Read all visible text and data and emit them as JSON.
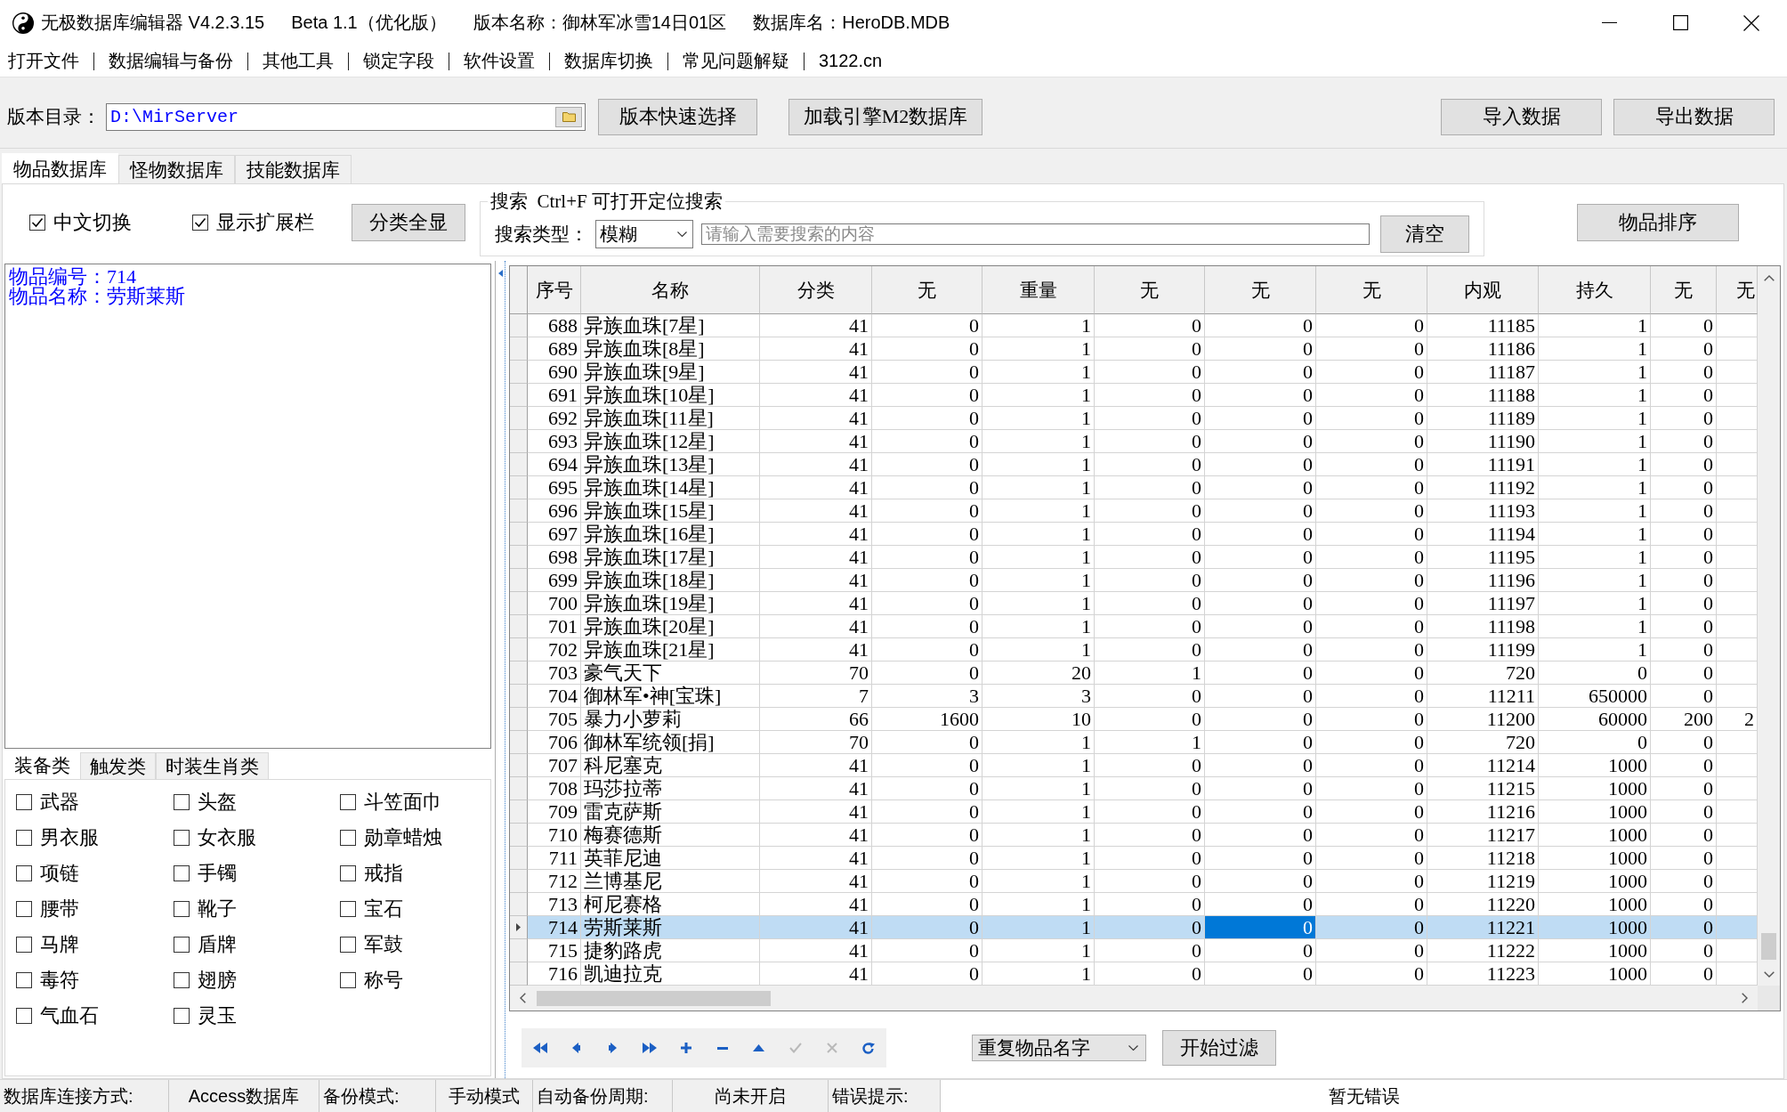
{
  "window": {
    "title_parts": [
      "无极数据库编辑器 V4.2.3.15",
      "Beta 1.1（优化版）",
      "版本名称：御林军冰雪14日01区",
      "数据库名：HeroDB.MDB"
    ]
  },
  "menu": [
    "打开文件",
    "数据编辑与备份",
    "其他工具",
    "锁定字段",
    "软件设置",
    "数据库切换",
    "常见问题解疑",
    "3122.cn"
  ],
  "toolbar": {
    "path_label": "版本目录：",
    "path_value": "D:\\MirServer",
    "left_buttons": [
      "版本快速选择",
      "加载引擎M2数据库"
    ],
    "right_buttons": [
      "导入数据",
      "导出数据"
    ]
  },
  "main_tabs": [
    {
      "label": "物品数据库",
      "selected": true
    },
    {
      "label": "怪物数据库",
      "selected": false
    },
    {
      "label": "技能数据库",
      "selected": false
    }
  ],
  "options": [
    {
      "label": "中文切换",
      "checked": true
    },
    {
      "label": "显示扩展栏",
      "checked": true
    }
  ],
  "show_all_button": "分类全显",
  "search": {
    "caption": "搜索  Ctrl+F 可打开定位搜索",
    "type_label": "搜索类型：",
    "type_value": "模糊",
    "placeholder": "请输入需要搜索的内容",
    "clear_button": "清空"
  },
  "sort_button": "物品排序",
  "item_info": [
    "物品编号：714",
    "物品名称：劳斯莱斯"
  ],
  "category_tabs": [
    {
      "label": "装备类",
      "selected": true
    },
    {
      "label": "触发类",
      "selected": false
    },
    {
      "label": "时装生肖类",
      "selected": false
    }
  ],
  "categories": [
    {
      "label": "武器",
      "checked": false
    },
    {
      "label": "头盔",
      "checked": false
    },
    {
      "label": "斗笠面巾",
      "checked": false
    },
    {
      "label": "男衣服",
      "checked": false
    },
    {
      "label": "女衣服",
      "checked": false
    },
    {
      "label": "勋章蜡烛",
      "checked": false
    },
    {
      "label": "项链",
      "checked": false
    },
    {
      "label": "手镯",
      "checked": false
    },
    {
      "label": "戒指",
      "checked": false
    },
    {
      "label": "腰带",
      "checked": false
    },
    {
      "label": "靴子",
      "checked": false
    },
    {
      "label": "宝石",
      "checked": false
    },
    {
      "label": "马牌",
      "checked": false
    },
    {
      "label": "盾牌",
      "checked": false
    },
    {
      "label": "军鼓",
      "checked": false
    },
    {
      "label": "毒符",
      "checked": false
    },
    {
      "label": "翅膀",
      "checked": false
    },
    {
      "label": "称号",
      "checked": false
    },
    {
      "label": "气血石",
      "checked": false
    },
    {
      "label": "灵玉",
      "checked": false
    }
  ],
  "table": {
    "columns": [
      {
        "label": "序号",
        "focused": false
      },
      {
        "label": "名称",
        "focused": false
      },
      {
        "label": "分类",
        "focused": false
      },
      {
        "label": "无",
        "focused": false
      },
      {
        "label": "重量",
        "focused": false
      },
      {
        "label": "无",
        "focused": false
      },
      {
        "label": "无",
        "focused": true
      },
      {
        "label": "无",
        "focused": false
      },
      {
        "label": "内观",
        "focused": false
      },
      {
        "label": "持久",
        "focused": false
      },
      {
        "label": "无",
        "focused": false
      },
      {
        "label": "无",
        "focused": false
      }
    ],
    "rows": [
      {
        "cells": [
          "688",
          "异族血珠[7星]",
          "41",
          "0",
          "1",
          "0",
          "0",
          "0",
          "11185",
          "1",
          "0"
        ],
        "selected": false
      },
      {
        "cells": [
          "689",
          "异族血珠[8星]",
          "41",
          "0",
          "1",
          "0",
          "0",
          "0",
          "11186",
          "1",
          "0"
        ],
        "selected": false
      },
      {
        "cells": [
          "690",
          "异族血珠[9星]",
          "41",
          "0",
          "1",
          "0",
          "0",
          "0",
          "11187",
          "1",
          "0"
        ],
        "selected": false
      },
      {
        "cells": [
          "691",
          "异族血珠[10星]",
          "41",
          "0",
          "1",
          "0",
          "0",
          "0",
          "11188",
          "1",
          "0"
        ],
        "selected": false
      },
      {
        "cells": [
          "692",
          "异族血珠[11星]",
          "41",
          "0",
          "1",
          "0",
          "0",
          "0",
          "11189",
          "1",
          "0"
        ],
        "selected": false
      },
      {
        "cells": [
          "693",
          "异族血珠[12星]",
          "41",
          "0",
          "1",
          "0",
          "0",
          "0",
          "11190",
          "1",
          "0"
        ],
        "selected": false
      },
      {
        "cells": [
          "694",
          "异族血珠[13星]",
          "41",
          "0",
          "1",
          "0",
          "0",
          "0",
          "11191",
          "1",
          "0"
        ],
        "selected": false
      },
      {
        "cells": [
          "695",
          "异族血珠[14星]",
          "41",
          "0",
          "1",
          "0",
          "0",
          "0",
          "11192",
          "1",
          "0"
        ],
        "selected": false
      },
      {
        "cells": [
          "696",
          "异族血珠[15星]",
          "41",
          "0",
          "1",
          "0",
          "0",
          "0",
          "11193",
          "1",
          "0"
        ],
        "selected": false
      },
      {
        "cells": [
          "697",
          "异族血珠[16星]",
          "41",
          "0",
          "1",
          "0",
          "0",
          "0",
          "11194",
          "1",
          "0"
        ],
        "selected": false
      },
      {
        "cells": [
          "698",
          "异族血珠[17星]",
          "41",
          "0",
          "1",
          "0",
          "0",
          "0",
          "11195",
          "1",
          "0"
        ],
        "selected": false
      },
      {
        "cells": [
          "699",
          "异族血珠[18星]",
          "41",
          "0",
          "1",
          "0",
          "0",
          "0",
          "11196",
          "1",
          "0"
        ],
        "selected": false
      },
      {
        "cells": [
          "700",
          "异族血珠[19星]",
          "41",
          "0",
          "1",
          "0",
          "0",
          "0",
          "11197",
          "1",
          "0"
        ],
        "selected": false
      },
      {
        "cells": [
          "701",
          "异族血珠[20星]",
          "41",
          "0",
          "1",
          "0",
          "0",
          "0",
          "11198",
          "1",
          "0"
        ],
        "selected": false
      },
      {
        "cells": [
          "702",
          "异族血珠[21星]",
          "41",
          "0",
          "1",
          "0",
          "0",
          "0",
          "11199",
          "1",
          "0"
        ],
        "selected": false
      },
      {
        "cells": [
          "703",
          "豪气天下",
          "70",
          "0",
          "20",
          "1",
          "0",
          "0",
          "720",
          "0",
          "0"
        ],
        "selected": false
      },
      {
        "cells": [
          "704",
          "御林军•神[宝珠]",
          "7",
          "3",
          "3",
          "0",
          "0",
          "0",
          "11211",
          "650000",
          "0"
        ],
        "selected": false
      },
      {
        "cells": [
          "705",
          "暴力小萝莉",
          "66",
          "1600",
          "10",
          "0",
          "0",
          "0",
          "11200",
          "60000",
          "200",
          "2"
        ],
        "selected": false
      },
      {
        "cells": [
          "706",
          "御林军统领[捐]",
          "70",
          "0",
          "1",
          "1",
          "0",
          "0",
          "720",
          "0",
          "0"
        ],
        "selected": false
      },
      {
        "cells": [
          "707",
          "科尼塞克",
          "41",
          "0",
          "1",
          "0",
          "0",
          "0",
          "11214",
          "1000",
          "0"
        ],
        "selected": false
      },
      {
        "cells": [
          "708",
          "玛莎拉蒂",
          "41",
          "0",
          "1",
          "0",
          "0",
          "0",
          "11215",
          "1000",
          "0"
        ],
        "selected": false
      },
      {
        "cells": [
          "709",
          "雷克萨斯",
          "41",
          "0",
          "1",
          "0",
          "0",
          "0",
          "11216",
          "1000",
          "0"
        ],
        "selected": false
      },
      {
        "cells": [
          "710",
          "梅赛德斯",
          "41",
          "0",
          "1",
          "0",
          "0",
          "0",
          "11217",
          "1000",
          "0"
        ],
        "selected": false
      },
      {
        "cells": [
          "711",
          "英菲尼迪",
          "41",
          "0",
          "1",
          "0",
          "0",
          "0",
          "11218",
          "1000",
          "0"
        ],
        "selected": false
      },
      {
        "cells": [
          "712",
          "兰博基尼",
          "41",
          "0",
          "1",
          "0",
          "0",
          "0",
          "11219",
          "1000",
          "0"
        ],
        "selected": false
      },
      {
        "cells": [
          "713",
          "柯尼赛格",
          "41",
          "0",
          "1",
          "0",
          "0",
          "0",
          "11220",
          "1000",
          "0"
        ],
        "selected": false
      },
      {
        "cells": [
          "714",
          "劳斯莱斯",
          "41",
          "0",
          "1",
          "0",
          "0",
          "0",
          "11221",
          "1000",
          "0"
        ],
        "selected": true
      },
      {
        "cells": [
          "715",
          "捷豹路虎",
          "41",
          "0",
          "1",
          "0",
          "0",
          "0",
          "11222",
          "1000",
          "0"
        ],
        "selected": false
      },
      {
        "cells": [
          "716",
          "凯迪拉克",
          "41",
          "0",
          "1",
          "0",
          "0",
          "0",
          "11223",
          "1000",
          "0"
        ],
        "selected": false
      }
    ]
  },
  "navigator": [
    {
      "disabled": false
    },
    {
      "disabled": false
    },
    {
      "disabled": false
    },
    {
      "disabled": false
    },
    {
      "disabled": false
    },
    {
      "disabled": false
    },
    {
      "disabled": false
    },
    {
      "disabled": true
    },
    {
      "disabled": true
    },
    {
      "disabled": false
    }
  ],
  "filter": {
    "value": "重复物品名字",
    "button": "开始过滤"
  },
  "status_bar": [
    {
      "label": "数据库连接方式:",
      "value": "Access数据库"
    },
    {
      "label": "备份模式:",
      "value": "手动模式"
    },
    {
      "label": "自动备份周期:",
      "value": "尚未开启"
    },
    {
      "label": "错误提示:",
      "value": "暂无错误"
    }
  ]
}
